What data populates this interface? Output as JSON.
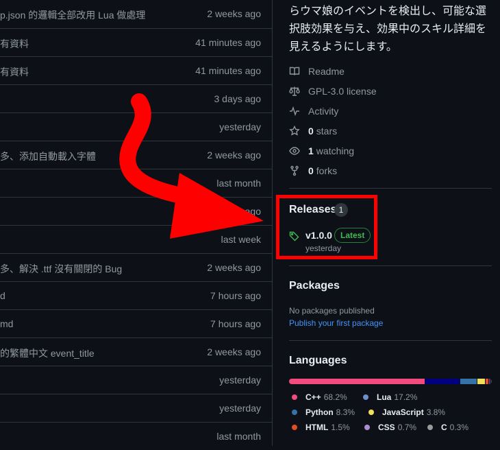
{
  "files": [
    {
      "message": "p.json 的邏輯全部改用 Lua 做處理",
      "time": "2 weeks ago"
    },
    {
      "message": "有資料",
      "time": "41 minutes ago"
    },
    {
      "message": "有資料",
      "time": "41 minutes ago"
    },
    {
      "message": "",
      "time": "3 days ago"
    },
    {
      "message": "",
      "time": "yesterday"
    },
    {
      "message": "多、添加自動載入字體",
      "time": "2 weeks ago"
    },
    {
      "message": "",
      "time": "last month"
    },
    {
      "message": "",
      "time": "ago"
    },
    {
      "message": "",
      "time": "last week"
    },
    {
      "message": "多、解決 .ttf 沒有關閉的 Bug",
      "time": "2 weeks ago"
    },
    {
      "message": "d",
      "time": "7 hours ago"
    },
    {
      "message": "md",
      "time": "7 hours ago"
    },
    {
      "message": "的繁體中文 event_title",
      "time": "2 weeks ago"
    },
    {
      "message": "",
      "time": "yesterday"
    },
    {
      "message": "",
      "time": "yesterday"
    },
    {
      "message": "",
      "time": "last month"
    }
  ],
  "about": {
    "description": "らウマ娘のイベントを検出し、可能な選択肢効果を与え、効果中のスキル詳細を見えるようにします。"
  },
  "meta": {
    "readme": "Readme",
    "license": "GPL-3.0 license",
    "activity": "Activity",
    "stars_count": "0",
    "stars_label": "stars",
    "watching_count": "1",
    "watching_label": "watching",
    "forks_count": "0",
    "forks_label": "forks"
  },
  "releases": {
    "title": "Releases",
    "count": "1",
    "version": "v1.0.0",
    "badge": "Latest",
    "date": "yesterday"
  },
  "packages": {
    "title": "Packages",
    "empty_text": "No packages published",
    "link": "Publish your first package"
  },
  "languages": {
    "title": "Languages",
    "items": [
      {
        "name": "C++",
        "percent": "68.2%",
        "color": "#f34b7d"
      },
      {
        "name": "Lua",
        "percent": "17.2%",
        "color": "#000080"
      },
      {
        "name": "Python",
        "percent": "8.3%",
        "color": "#3572A5"
      },
      {
        "name": "JavaScript",
        "percent": "3.8%",
        "color": "#f1e05a"
      },
      {
        "name": "HTML",
        "percent": "1.5%",
        "color": "#e34c26"
      },
      {
        "name": "CSS",
        "percent": "0.7%",
        "color": "#563d7c"
      },
      {
        "name": "C",
        "percent": "0.3%",
        "color": "#555555"
      }
    ]
  },
  "colors": {
    "background": "#0d1117",
    "border": "#30363d",
    "highlight_box": "#ff0000",
    "arrow": "#ff0000",
    "latest_green": "#3fb950",
    "link_blue": "#4493f8"
  }
}
